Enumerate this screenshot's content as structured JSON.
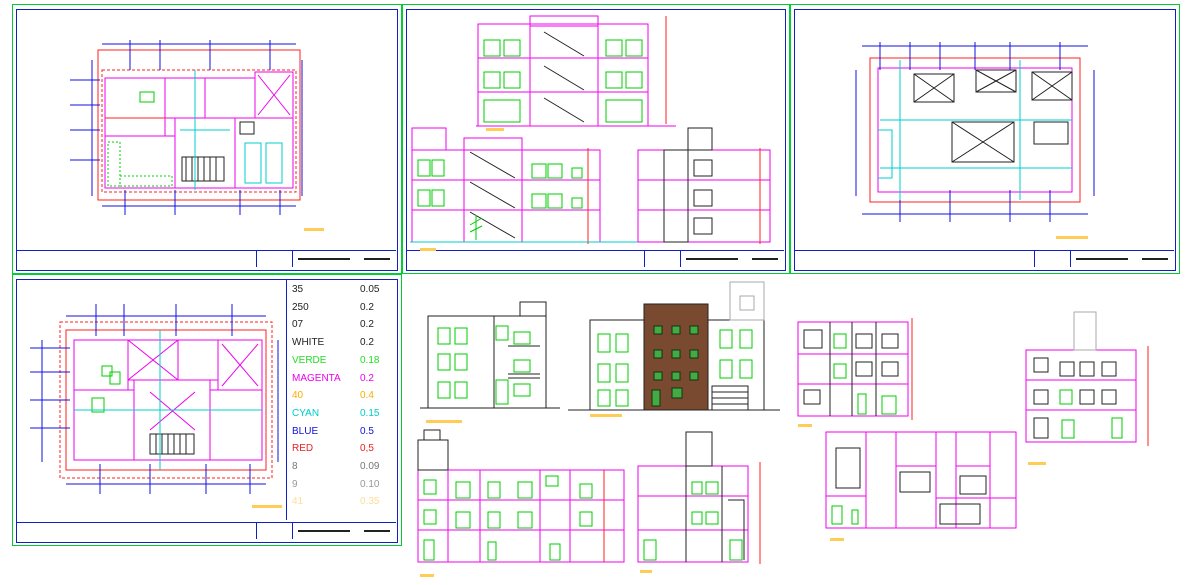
{
  "canvas_background": "#ffffff",
  "colors": {
    "sheet_border": "#00cc33",
    "frame_border": "#1020c0",
    "wall_red": "#ff2020",
    "wall_magenta": "#ee00ee",
    "green": "#00cc00",
    "cyan": "#00cccc",
    "blue": "#1010dd",
    "brown_facade": "#7a4a30",
    "label_tag": "#ffcc55"
  },
  "legend": {
    "rows": [
      {
        "name": "35",
        "value": "0.05",
        "color": "#222222"
      },
      {
        "name": "250",
        "value": "0.2",
        "color": "#222222"
      },
      {
        "name": "07",
        "value": "0.2",
        "color": "#222222"
      },
      {
        "name": "WHITE",
        "value": "0.2",
        "color": "#222222"
      },
      {
        "name": "VERDE",
        "value": "0.18",
        "color": "#22dd22"
      },
      {
        "name": "MAGENTA",
        "value": "0.2",
        "color": "#ee00ee"
      },
      {
        "name": "40",
        "value": "0.4",
        "color": "#ffaa00"
      },
      {
        "name": "CYAN",
        "value": "0.15",
        "color": "#00cccc"
      },
      {
        "name": "BLUE",
        "value": "0.5",
        "color": "#1010dd"
      },
      {
        "name": "RED",
        "value": "0,5",
        "color": "#ee2020"
      },
      {
        "name": "8",
        "value": "0.09",
        "color": "#777777"
      },
      {
        "name": "9",
        "value": "0.10",
        "color": "#999999"
      },
      {
        "name": "41",
        "value": "0.35",
        "color": "#ffdd99"
      }
    ]
  },
  "drawings": [
    {
      "name": "first-floor-plan"
    },
    {
      "name": "building-sections"
    },
    {
      "name": "roof-plan"
    },
    {
      "name": "second-floor-plan"
    },
    {
      "name": "front-elevations"
    },
    {
      "name": "longitudinal-elevations"
    },
    {
      "name": "detail-sections"
    }
  ]
}
